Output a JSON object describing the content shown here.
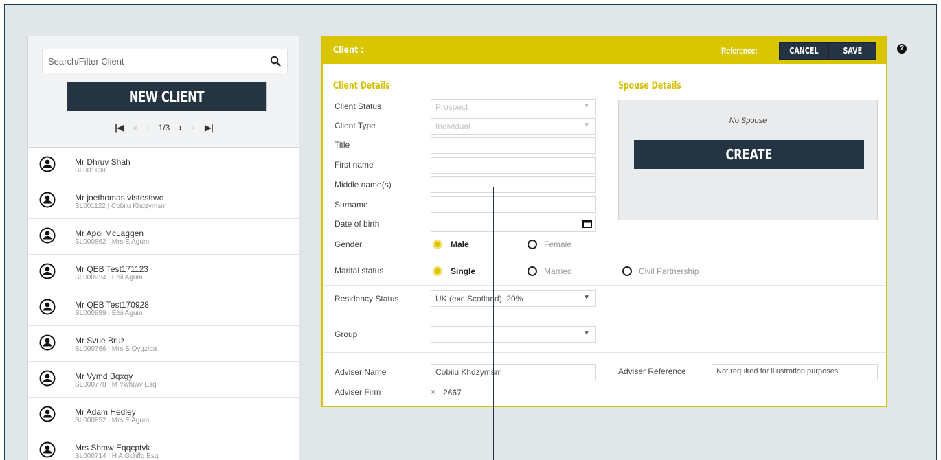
{
  "sidebar": {
    "search_placeholder": "Search/Filter Client",
    "new_client_label": "NEW CLIENT",
    "pager": {
      "first": "|◀",
      "prev2": "«",
      "prev": "‹",
      "page": "1/3",
      "next": "›",
      "next2": "»",
      "last": "▶|"
    },
    "clients": [
      {
        "name": "Mr Dhruv Shah",
        "ref": "SL001139"
      },
      {
        "name": "Mr joethomas vfstesttwo",
        "ref": "SL001122 | Cobiiu Khdzymsm"
      },
      {
        "name": "Mr Apoi McLaggen",
        "ref": "SL000862 | Mrs E Agum"
      },
      {
        "name": "Mr QEB Test171123",
        "ref": "SL000924 | Eeii Agum"
      },
      {
        "name": "Mr QEB Test170928",
        "ref": "SL000889 | Eeii Agum"
      },
      {
        "name": "Mr Svue Bruz",
        "ref": "SL000766 | Mrs S Oygziga"
      },
      {
        "name": "Mr Vymd Bqxgy",
        "ref": "SL000778 | M Ywhjwv Esq"
      },
      {
        "name": "Mr Adam Hedley",
        "ref": "SL000852 | Mrs E Agum"
      },
      {
        "name": "Mrs Shmw Eqqcptvk",
        "ref": "SL000714 | H A Gchffg Esq"
      }
    ]
  },
  "panel": {
    "title": "Client :",
    "reference_label": "Reference:",
    "cancel_label": "CANCEL",
    "save_label": "SAVE",
    "client_details_title": "Client Details",
    "spouse_details_title": "Spouse Details",
    "labels": {
      "client_status": "Client Status",
      "client_type": "Client Type",
      "title": "Title",
      "first_name": "First name",
      "middle_names": "Middle name(s)",
      "surname": "Surname",
      "dob": "Date of birth",
      "gender": "Gender",
      "marital_status": "Marital status",
      "residency_status": "Residency Status",
      "group": "Group",
      "adviser_name": "Adviser Name",
      "adviser_firm": "Adviser Firm",
      "adviser_reference": "Adviser Reference"
    },
    "values": {
      "client_status": "Prospect",
      "client_type": "Individual",
      "title": "",
      "first_name": "",
      "middle_names": "",
      "surname": "",
      "dob": "",
      "residency_status": "UK (exc Scotland): 20%",
      "group": "",
      "adviser_name": "Cobiiu Khdzymsm",
      "adviser_firm": "2667",
      "adviser_firm_icon": "×",
      "adviser_reference": "Not required for illustration purposes"
    },
    "gender_options": {
      "male": "Male",
      "female": "Female",
      "selected": "Male"
    },
    "marital_options": {
      "single": "Single",
      "married": "Married",
      "civil": "Civil Partnership",
      "selected": "Single"
    },
    "spouse": {
      "no_spouse": "No Spouse",
      "create_label": "CREATE"
    }
  },
  "help_icon": "?",
  "colors": {
    "accent": "#d9c500",
    "navy": "#243443",
    "background": "#e1e6e9"
  }
}
